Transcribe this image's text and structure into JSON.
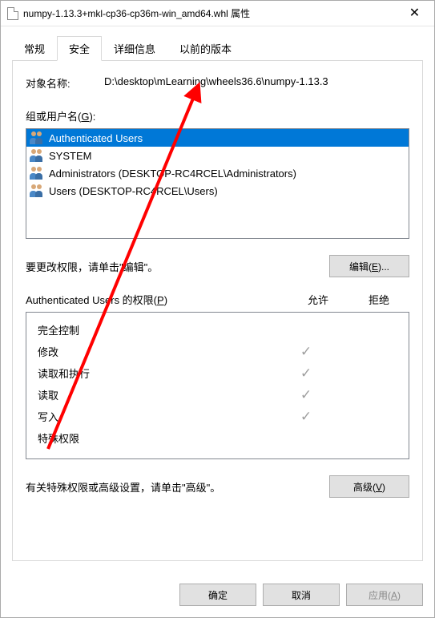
{
  "window": {
    "title": "numpy-1.13.3+mkl-cp36-cp36m-win_amd64.whl 属性"
  },
  "tabs": {
    "general": "常规",
    "security": "安全",
    "details": "详细信息",
    "previous": "以前的版本"
  },
  "object": {
    "label": "对象名称:",
    "value": "D:\\desktop\\mLearning\\wheels36.6\\numpy-1.13.3"
  },
  "groups": {
    "label": "组或用户名(G):",
    "items": [
      "Authenticated Users",
      "SYSTEM",
      "Administrators (DESKTOP-RC4RCEL\\Administrators)",
      "Users (DESKTOP-RC4RCEL\\Users)"
    ]
  },
  "edit": {
    "hint": "要更改权限，请单击\"编辑\"。",
    "button": "编辑(E)..."
  },
  "permissions": {
    "header": "Authenticated Users 的权限(P)",
    "col_allow": "允许",
    "col_deny": "拒绝",
    "rows": {
      "full_control": {
        "name": "完全控制",
        "allow": false,
        "deny": false
      },
      "modify": {
        "name": "修改",
        "allow": true,
        "deny": false
      },
      "read_exec": {
        "name": "读取和执行",
        "allow": true,
        "deny": false
      },
      "read": {
        "name": "读取",
        "allow": true,
        "deny": false
      },
      "write": {
        "name": "写入",
        "allow": true,
        "deny": false
      },
      "special": {
        "name": "特殊权限",
        "allow": false,
        "deny": false
      }
    }
  },
  "advanced": {
    "hint": "有关特殊权限或高级设置，请单击\"高级\"。",
    "button": "高级(V)"
  },
  "buttons": {
    "ok": "确定",
    "cancel": "取消",
    "apply": "应用(A)"
  },
  "icons": {
    "file": "file-icon",
    "close": "close-icon",
    "users": "users-icon",
    "check": "check-icon"
  },
  "annotation": {
    "arrow_color": "#ff0000"
  }
}
